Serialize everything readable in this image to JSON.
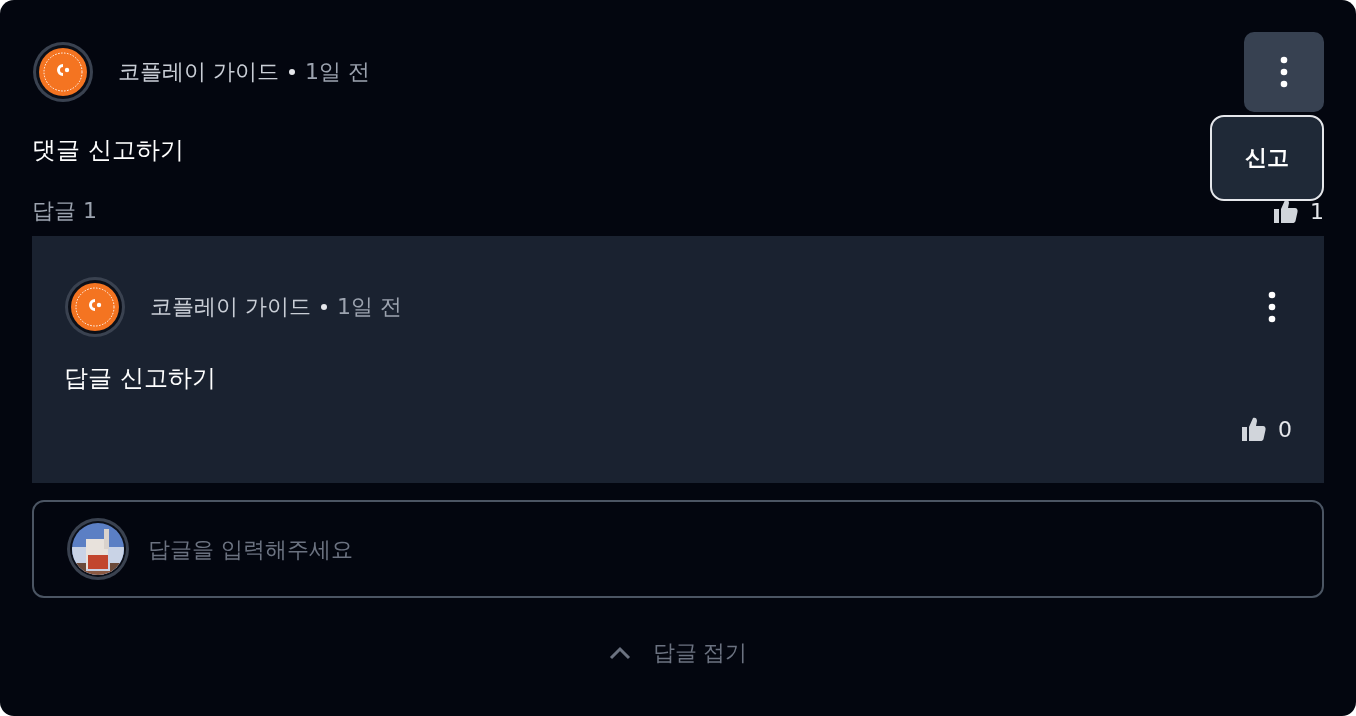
{
  "comment": {
    "author": "코플레이 가이드",
    "time": "1일 전",
    "text": "댓글 신고하기",
    "reply_count": "답글 1",
    "likes": "1"
  },
  "menu": {
    "open": true,
    "items": [
      "신고"
    ]
  },
  "replies": [
    {
      "author": "코플레이 가이드",
      "time": "1일 전",
      "text": "답글 신고하기",
      "likes": "0"
    }
  ],
  "reply_input": {
    "placeholder": "답글을 입력해주세요"
  },
  "collapse": {
    "label": "답글 접기"
  }
}
